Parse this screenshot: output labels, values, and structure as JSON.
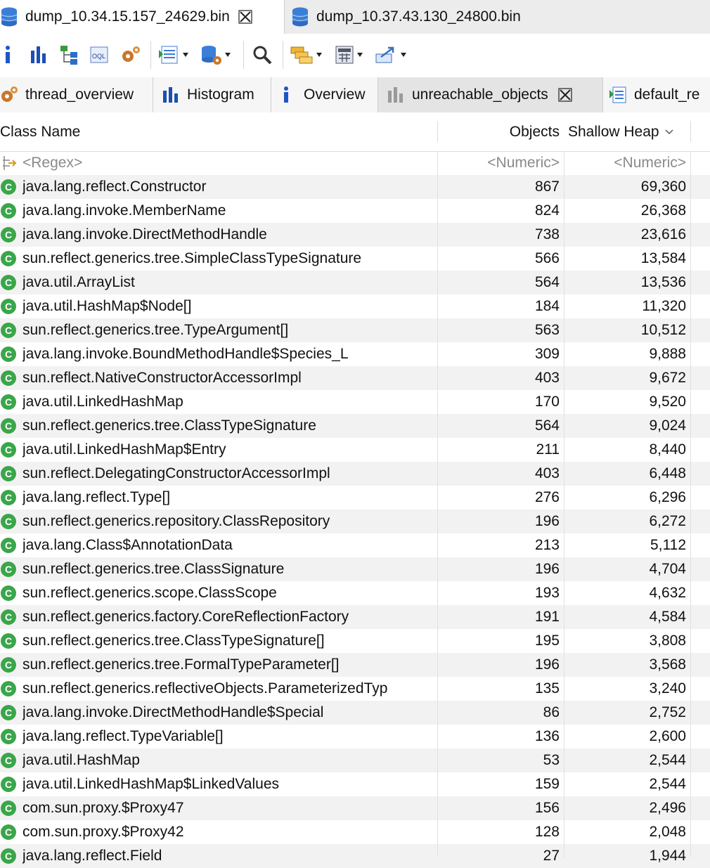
{
  "editor_tabs": [
    {
      "label": "dump_10.34.15.157_24629.bin",
      "active": true
    },
    {
      "label": "dump_10.37.43.130_24800.bin",
      "active": false
    }
  ],
  "toolbar": {
    "icons": [
      "info-icon",
      "histogram-icon",
      "dominator-tree-icon",
      "oql-icon",
      "gear-icon",
      "reports-icon",
      "query-browser-icon",
      "search-icon",
      "group-icon",
      "calculator-icon",
      "export-icon"
    ]
  },
  "view_tabs": [
    {
      "label": "thread_overview",
      "icon": "gears-icon"
    },
    {
      "label": "Histogram",
      "icon": "histogram-icon"
    },
    {
      "label": "Overview",
      "icon": "info-icon"
    },
    {
      "label": "unreachable_objects",
      "icon": "histogram-icon",
      "active": true
    },
    {
      "label": "default_re",
      "icon": "report-icon"
    }
  ],
  "table": {
    "columns": {
      "name": "Class Name",
      "objects": "Objects",
      "shallow_heap": "Shallow Heap"
    },
    "filter": {
      "name": "<Regex>",
      "objects": "<Numeric>",
      "shallow_heap": "<Numeric>"
    },
    "rows": [
      {
        "name": "java.lang.reflect.Constructor",
        "objects": "867",
        "shallow_heap": "69,360"
      },
      {
        "name": "java.lang.invoke.MemberName",
        "objects": "824",
        "shallow_heap": "26,368"
      },
      {
        "name": "java.lang.invoke.DirectMethodHandle",
        "objects": "738",
        "shallow_heap": "23,616"
      },
      {
        "name": "sun.reflect.generics.tree.SimpleClassTypeSignature",
        "objects": "566",
        "shallow_heap": "13,584"
      },
      {
        "name": "java.util.ArrayList",
        "objects": "564",
        "shallow_heap": "13,536"
      },
      {
        "name": "java.util.HashMap$Node[]",
        "objects": "184",
        "shallow_heap": "11,320"
      },
      {
        "name": "sun.reflect.generics.tree.TypeArgument[]",
        "objects": "563",
        "shallow_heap": "10,512"
      },
      {
        "name": "java.lang.invoke.BoundMethodHandle$Species_L",
        "objects": "309",
        "shallow_heap": "9,888"
      },
      {
        "name": "sun.reflect.NativeConstructorAccessorImpl",
        "objects": "403",
        "shallow_heap": "9,672"
      },
      {
        "name": "java.util.LinkedHashMap",
        "objects": "170",
        "shallow_heap": "9,520"
      },
      {
        "name": "sun.reflect.generics.tree.ClassTypeSignature",
        "objects": "564",
        "shallow_heap": "9,024"
      },
      {
        "name": "java.util.LinkedHashMap$Entry",
        "objects": "211",
        "shallow_heap": "8,440"
      },
      {
        "name": "sun.reflect.DelegatingConstructorAccessorImpl",
        "objects": "403",
        "shallow_heap": "6,448"
      },
      {
        "name": "java.lang.reflect.Type[]",
        "objects": "276",
        "shallow_heap": "6,296"
      },
      {
        "name": "sun.reflect.generics.repository.ClassRepository",
        "objects": "196",
        "shallow_heap": "6,272"
      },
      {
        "name": "java.lang.Class$AnnotationData",
        "objects": "213",
        "shallow_heap": "5,112"
      },
      {
        "name": "sun.reflect.generics.tree.ClassSignature",
        "objects": "196",
        "shallow_heap": "4,704"
      },
      {
        "name": "sun.reflect.generics.scope.ClassScope",
        "objects": "193",
        "shallow_heap": "4,632"
      },
      {
        "name": "sun.reflect.generics.factory.CoreReflectionFactory",
        "objects": "191",
        "shallow_heap": "4,584"
      },
      {
        "name": "sun.reflect.generics.tree.ClassTypeSignature[]",
        "objects": "195",
        "shallow_heap": "3,808"
      },
      {
        "name": "sun.reflect.generics.tree.FormalTypeParameter[]",
        "objects": "196",
        "shallow_heap": "3,568"
      },
      {
        "name": "sun.reflect.generics.reflectiveObjects.ParameterizedTyp",
        "objects": "135",
        "shallow_heap": "3,240"
      },
      {
        "name": "java.lang.invoke.DirectMethodHandle$Special",
        "objects": "86",
        "shallow_heap": "2,752"
      },
      {
        "name": "java.lang.reflect.TypeVariable[]",
        "objects": "136",
        "shallow_heap": "2,600"
      },
      {
        "name": "java.util.HashMap",
        "objects": "53",
        "shallow_heap": "2,544"
      },
      {
        "name": "java.util.LinkedHashMap$LinkedValues",
        "objects": "159",
        "shallow_heap": "2,544"
      },
      {
        "name": "com.sun.proxy.$Proxy47",
        "objects": "156",
        "shallow_heap": "2,496"
      },
      {
        "name": "com.sun.proxy.$Proxy42",
        "objects": "128",
        "shallow_heap": "2,048"
      },
      {
        "name": "java.lang.reflect.Field",
        "objects": "27",
        "shallow_heap": "1,944"
      }
    ]
  },
  "colors": {
    "class_icon": "#3aa64a",
    "alt_row": "#f2f2f2",
    "active_tab": "#e4e4e4"
  }
}
